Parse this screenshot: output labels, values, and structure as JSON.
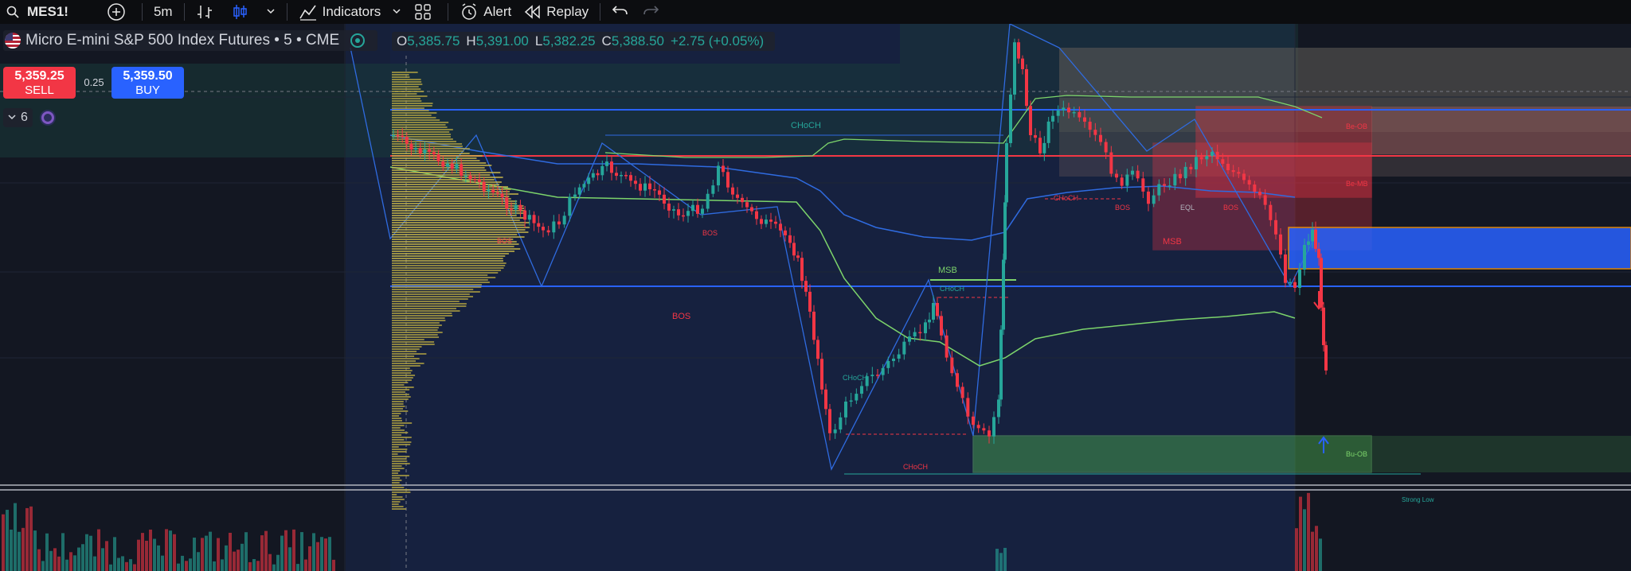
{
  "toolbar": {
    "symbol": "MES1!",
    "interval": "5m",
    "indicators_label": "Indicators",
    "alert_label": "Alert",
    "replay_label": "Replay"
  },
  "legend": {
    "title": "Micro E-mini S&P 500 Index Futures • 5 • CME",
    "o_key": "O",
    "o_val": "5,385.75",
    "h_key": "H",
    "h_val": "5,391.00",
    "l_key": "L",
    "l_val": "5,382.25",
    "c_key": "C",
    "c_val": "5,388.50",
    "change": "+2.75 (+0.05%)"
  },
  "trade": {
    "sell_price": "5,359.25",
    "sell_label": "SELL",
    "spread": "0.25",
    "buy_price": "5,359.50",
    "buy_label": "BUY"
  },
  "indicators_count": "6",
  "annotations": {
    "choch": "CHoCH",
    "bos": "BOS",
    "msb": "MSB",
    "eql": "EQL",
    "be_ob": "Be-OB",
    "be_mb": "Be-MB",
    "bu_ob": "Bu-OB",
    "strong_low": "Strong Low"
  },
  "colors": {
    "background": "#131722",
    "bull": "#26a69a",
    "bear": "#f23645",
    "blue_line": "#2962ff",
    "red_line": "#f23645",
    "green_ma": "#7cd46b",
    "blue_ma": "#2f6be0",
    "volume_profile": "#b5a642"
  }
}
